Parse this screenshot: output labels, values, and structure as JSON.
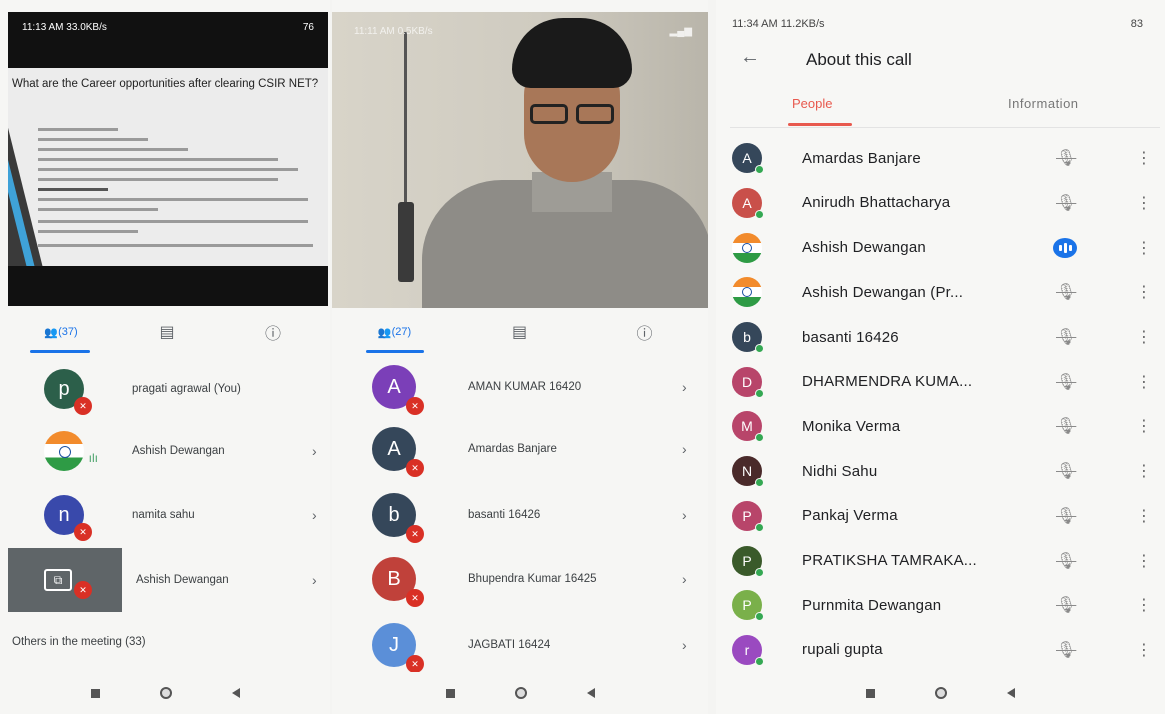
{
  "panel1": {
    "status_time": "11:13 AM",
    "status_speed": "33.0KB/s",
    "status_battery": "76",
    "slide_title": "What are the Career opportunities after clearing CSIR NET?",
    "tabs": {
      "people_count": "(37)"
    },
    "participants": [
      {
        "name": "pragati agrawal (You)",
        "initial": "p",
        "color": "#2c5f4a",
        "muted": true,
        "chevron": false
      },
      {
        "name": "Ashish Dewangan",
        "initial": "",
        "color": "flag",
        "muted": false,
        "chevron": true
      },
      {
        "name": "namita sahu",
        "initial": "n",
        "color": "#3949ab",
        "muted": true,
        "chevron": true
      },
      {
        "name": "Ashish Dewangan",
        "initial": "",
        "color": "screen",
        "muted": true,
        "chevron": true
      }
    ],
    "others_label": "Others in the meeting (33)"
  },
  "panel2": {
    "status_time": "11:11 AM",
    "status_speed": "0.5KB/s",
    "tabs": {
      "people_count": "(27)"
    },
    "participants": [
      {
        "name": "AMAN KUMAR 16420",
        "initial": "A",
        "color": "#7b3fb8"
      },
      {
        "name": "Amardas Banjare",
        "initial": "A",
        "color": "#35475a"
      },
      {
        "name": "basanti 16426",
        "initial": "b",
        "color": "#35475a"
      },
      {
        "name": "Bhupendra Kumar 16425",
        "initial": "B",
        "color": "#c0413a"
      },
      {
        "name": "JAGBATI 16424",
        "initial": "J",
        "color": "#5b8fd8"
      }
    ]
  },
  "panel3": {
    "status_time": "11:34 AM",
    "status_speed": "11.2KB/s",
    "status_battery": "83",
    "title": "About this call",
    "tab_people": "People",
    "tab_information": "Information",
    "participants": [
      {
        "name": "Amardas Banjare",
        "initial": "A",
        "color": "#35475a",
        "talking": false
      },
      {
        "name": "Anirudh Bhattacharya",
        "initial": "A",
        "color": "#c9504a",
        "talking": false
      },
      {
        "name": "Ashish Dewangan",
        "initial": "",
        "color": "flag",
        "talking": true
      },
      {
        "name": "Ashish Dewangan (Pr...",
        "initial": "",
        "color": "flag",
        "talking": false
      },
      {
        "name": "basanti 16426",
        "initial": "b",
        "color": "#35475a",
        "talking": false
      },
      {
        "name": "DHARMENDRA KUMA...",
        "initial": "D",
        "color": "#b8456a",
        "talking": false
      },
      {
        "name": "Monika Verma",
        "initial": "M",
        "color": "#b8456a",
        "talking": false
      },
      {
        "name": "Nidhi Sahu",
        "initial": "N",
        "color": "#4a2a2a",
        "talking": false
      },
      {
        "name": "Pankaj Verma",
        "initial": "P",
        "color": "#b8456a",
        "talking": false
      },
      {
        "name": "PRATIKSHA TAMRAKA...",
        "initial": "P",
        "color": "#3a5a2a",
        "talking": false
      },
      {
        "name": "Purnmita Dewangan",
        "initial": "P",
        "color": "#7ab04a",
        "talking": false
      },
      {
        "name": "rupali gupta",
        "initial": "r",
        "color": "#9a4ac0",
        "talking": false
      }
    ]
  },
  "icons": {
    "people": "👥",
    "chat": "▤",
    "info": "ⓘ",
    "chevron": "›",
    "mic_off": "✕",
    "back_arrow": "←",
    "more": "⋮",
    "present": "⧉"
  }
}
